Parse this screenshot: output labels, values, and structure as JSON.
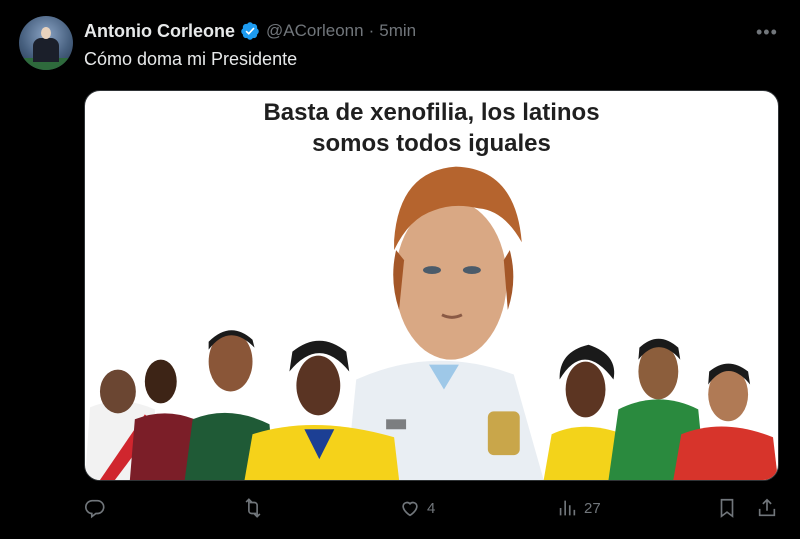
{
  "author": {
    "display_name": "Antonio Corleone",
    "handle": "@ACorleonn",
    "separator": "·",
    "time": "5min",
    "verified": true
  },
  "tweet": {
    "text": "Cómo doma mi Presidente"
  },
  "media": {
    "caption_line1": "Basta de xenofilia, los latinos",
    "caption_line2": "somos todos iguales"
  },
  "actions": {
    "reply_count": "",
    "retweet_count": "",
    "like_count": "4",
    "views_count": "27"
  },
  "icons": {
    "verified": "verified-badge-icon",
    "more": "more-options-icon",
    "reply": "reply-icon",
    "retweet": "retweet-icon",
    "like": "heart-icon",
    "views": "views-chart-icon",
    "bookmark": "bookmark-icon",
    "share": "share-icon"
  },
  "colors": {
    "background": "#000000",
    "text": "#e7e9ea",
    "muted": "#71767b",
    "verified": "#1d9bf0"
  }
}
